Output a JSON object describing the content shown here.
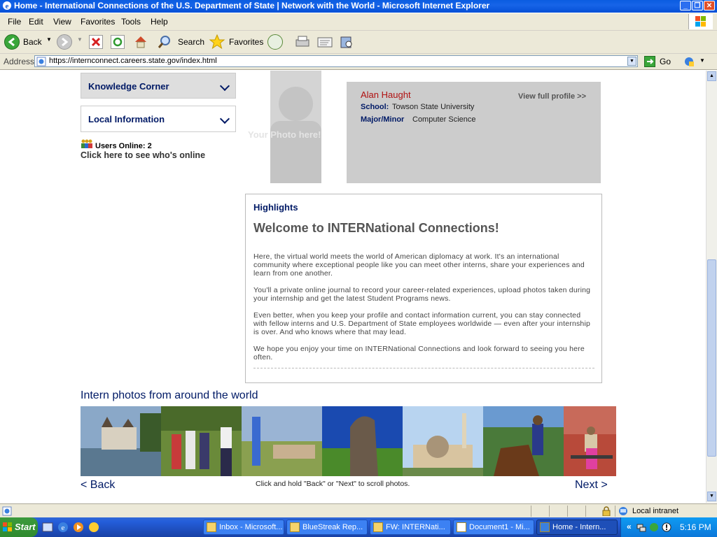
{
  "window": {
    "title": "Home - International Connections of the U.S. Department of State | Network with the World - Microsoft Internet Explorer",
    "min": "_",
    "max": "❐",
    "close": "✕"
  },
  "menu": [
    "File",
    "Edit",
    "View",
    "Favorites",
    "Tools",
    "Help"
  ],
  "toolbar": {
    "back": "Back",
    "search": "Search",
    "favorites": "Favorites"
  },
  "address": {
    "label": "Address",
    "url": "https://internconnect.careers.state.gov/index.html",
    "go": "Go"
  },
  "sidebar": {
    "items": [
      {
        "label": "Knowledge Corner"
      },
      {
        "label": "Local Information"
      }
    ],
    "users_online": "Users Online: 2",
    "see_who": "Click here to see who's online"
  },
  "photo_placeholder": "Your Photo here!",
  "profile": {
    "name": "Alan Haught",
    "view_full": "View full profile >>",
    "school_label": "School:",
    "school_value": "Towson State University",
    "major_label": "Major/Minor",
    "major_value": "Computer Science"
  },
  "highlights": {
    "heading": "Highlights",
    "title": "Welcome to INTERNational Connections!",
    "paragraphs": [
      "Here, the virtual world meets the world of American diplomacy at work. It's an international community where exceptional people like you can meet other interns, share your experiences and learn from one another.",
      "You'll a private online journal to record your career-related experiences, upload photos taken during your internship and get the latest Student Programs news.",
      "Even better, when you keep your profile and contact information current, you can stay connected with fellow interns and U.S. Department of State employees worldwide — even after your internship is over. And who knows where that may lead.",
      "We hope you enjoy your time on INTERNational Connections and look forward to seeing you here often."
    ]
  },
  "gallery": {
    "title": "Intern photos from around the world",
    "back": "< Back",
    "next": "Next >",
    "hint": "Click and hold \"Back\" or \"Next\" to scroll photos."
  },
  "status": {
    "zone": "Local intranet"
  },
  "taskbar": {
    "start": "Start",
    "tasks": [
      {
        "label": "Inbox - Microsoft..."
      },
      {
        "label": "BlueStreak Rep..."
      },
      {
        "label": "FW: INTERNati..."
      },
      {
        "label": "Document1 - Mi..."
      },
      {
        "label": "Home - Intern..."
      }
    ],
    "clock": "5:16 PM",
    "chevron": "«"
  },
  "colors": {
    "accent_navy": "#001a66",
    "profile_name": "#b01010",
    "profile_bg": "#cccccc",
    "xp_blue": "#0a5ce0"
  }
}
